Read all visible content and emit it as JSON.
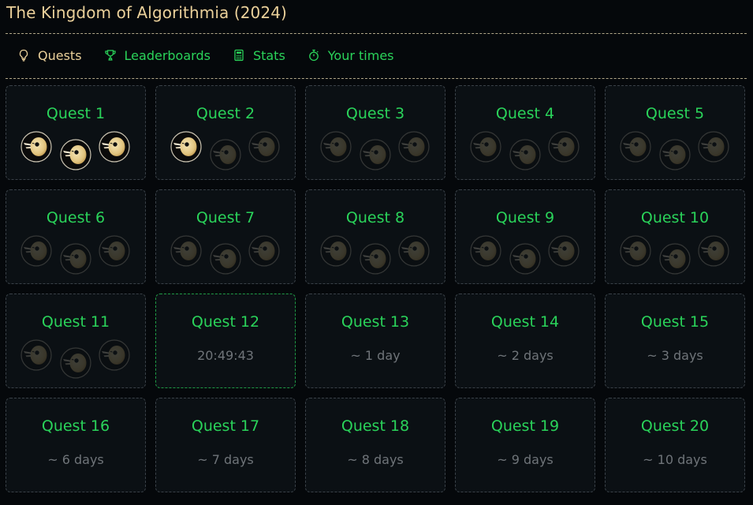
{
  "header": {
    "title": "The Kingdom of Algorithmia (2024)"
  },
  "nav": [
    {
      "label": "Quests",
      "icon": "lightbulb-icon",
      "active": true
    },
    {
      "label": "Leaderboards",
      "icon": "trophy-icon",
      "active": false
    },
    {
      "label": "Stats",
      "icon": "calculator-icon",
      "active": false
    },
    {
      "label": "Your times",
      "icon": "stopwatch-icon",
      "active": false
    }
  ],
  "colors": {
    "accent_green": "#2ad35a",
    "title_gold": "#ead09a",
    "muted": "#6f7479",
    "background": "#05080b"
  },
  "quests": [
    {
      "title": "Quest 1",
      "medals": [
        true,
        true,
        true
      ]
    },
    {
      "title": "Quest 2",
      "medals": [
        true,
        false,
        false
      ]
    },
    {
      "title": "Quest 3",
      "medals": [
        false,
        false,
        false
      ]
    },
    {
      "title": "Quest 4",
      "medals": [
        false,
        false,
        false
      ]
    },
    {
      "title": "Quest 5",
      "medals": [
        false,
        false,
        false
      ]
    },
    {
      "title": "Quest 6",
      "medals": [
        false,
        false,
        false
      ]
    },
    {
      "title": "Quest 7",
      "medals": [
        false,
        false,
        false
      ]
    },
    {
      "title": "Quest 8",
      "medals": [
        false,
        false,
        false
      ]
    },
    {
      "title": "Quest 9",
      "medals": [
        false,
        false,
        false
      ]
    },
    {
      "title": "Quest 10",
      "medals": [
        false,
        false,
        false
      ]
    },
    {
      "title": "Quest 11",
      "medals": [
        false,
        false,
        false
      ]
    },
    {
      "title": "Quest 12",
      "countdown": "20:49:43",
      "current": true
    },
    {
      "title": "Quest 13",
      "countdown": "~ 1 day"
    },
    {
      "title": "Quest 14",
      "countdown": "~ 2 days"
    },
    {
      "title": "Quest 15",
      "countdown": "~ 3 days"
    },
    {
      "title": "Quest 16",
      "countdown": "~ 6 days"
    },
    {
      "title": "Quest 17",
      "countdown": "~ 7 days"
    },
    {
      "title": "Quest 18",
      "countdown": "~ 8 days"
    },
    {
      "title": "Quest 19",
      "countdown": "~ 9 days"
    },
    {
      "title": "Quest 20",
      "countdown": "~ 10 days"
    }
  ]
}
